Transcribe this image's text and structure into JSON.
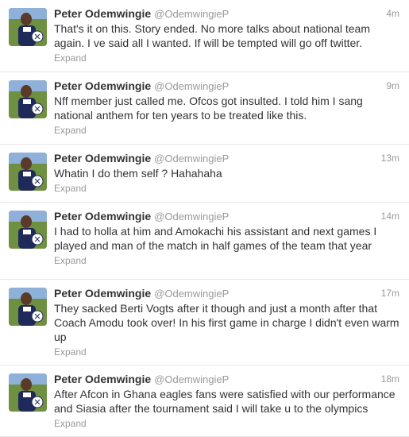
{
  "tweets": [
    {
      "fullname": "Peter Odemwingie",
      "username": "@OdemwingieP",
      "time": "4m",
      "text": "That's it on this. Story ended. No more talks about national team again. I ve said all I wanted. If will be tempted will go off twitter.",
      "expand": "Expand"
    },
    {
      "fullname": "Peter Odemwingie",
      "username": "@OdemwingieP",
      "time": "9m",
      "text": "Nff member just called me. Ofcos got insulted. I told him I sang national anthem for ten years to be treated like this.",
      "expand": "Expand"
    },
    {
      "fullname": "Peter Odemwingie",
      "username": "@OdemwingieP",
      "time": "13m",
      "text": "Whatin I do them self ? Hahahaha",
      "expand": "Expand"
    },
    {
      "fullname": "Peter Odemwingie",
      "username": "@OdemwingieP",
      "time": "14m",
      "text": "I had to holla at him and Amokachi his assistant and next games I played and man of the match in half games of the team that year",
      "expand": "Expand"
    },
    {
      "fullname": "Peter Odemwingie",
      "username": "@OdemwingieP",
      "time": "17m",
      "text": "They sacked Berti Vogts after it though and just a month after that Coach Amodu took over! In his first game in charge I didn't even warm up",
      "expand": "Expand"
    },
    {
      "fullname": "Peter Odemwingie",
      "username": "@OdemwingieP",
      "time": "18m",
      "text": "After Afcon in Ghana eagles fans were satisfied with our performance and Siasia after the tournament said I will take u to the olympics",
      "expand": "Expand"
    }
  ]
}
